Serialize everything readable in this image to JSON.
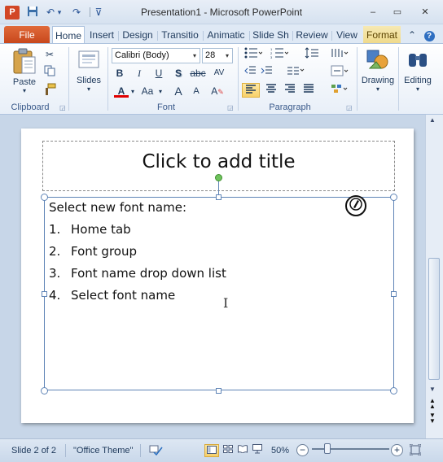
{
  "window": {
    "app_icon_letter": "P",
    "title": "Presentation1  -  Microsoft PowerPoint",
    "min_glyph": "–",
    "max_glyph": "▭",
    "close_glyph": "✕"
  },
  "qat": {
    "save_glyph": "💾",
    "undo_glyph": "↶",
    "undo_dd": "▾",
    "redo_glyph": "↷",
    "customize_glyph": "⊽"
  },
  "tabs": {
    "file": "File",
    "items": [
      "Home",
      "Insert",
      "Design",
      "Transitio",
      "Animatic",
      "Slide Sh",
      "Review",
      "View"
    ],
    "format": "Format",
    "help_glyph": "?",
    "collapse_glyph": "⌃"
  },
  "ribbon": {
    "clipboard": {
      "paste_label": "Paste",
      "group_label": "Clipboard"
    },
    "slides": {
      "label": "Slides"
    },
    "font": {
      "font_name": "Calibri (Body)",
      "font_size": "28",
      "bold": "B",
      "italic": "I",
      "underline": "U",
      "shadow": "S",
      "strike": "abc",
      "spacing": "AV",
      "font_color": "A",
      "change_case": "Aa",
      "grow": "A",
      "shrink": "A",
      "clear": "A",
      "group_label": "Font"
    },
    "paragraph": {
      "group_label": "Paragraph"
    },
    "drawing": {
      "label": "Drawing"
    },
    "editing": {
      "label": "Editing"
    }
  },
  "slide": {
    "title_placeholder": "Click to add title",
    "body_intro": "Select new font name:",
    "list": [
      {
        "num": "1.",
        "text": "Home tab"
      },
      {
        "num": "2.",
        "text": "Font group"
      },
      {
        "num": "3.",
        "text": "Font name drop down list"
      },
      {
        "num": "4.",
        "text": "Select font name"
      }
    ]
  },
  "status": {
    "slide_info": "Slide 2 of 2",
    "theme": "\"Office Theme\"",
    "zoom": "50%",
    "zoom_minus": "−",
    "zoom_plus": "+"
  },
  "colors": {
    "file_tab": "#c7461b",
    "format_tab": "#efd98a",
    "font_color_bar": "#e00000"
  }
}
